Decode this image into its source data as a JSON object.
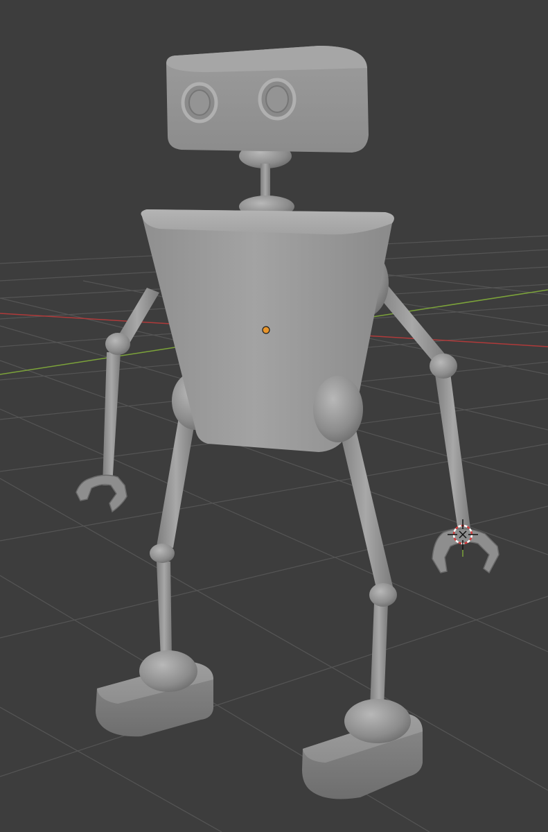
{
  "viewport": {
    "background": "#3d3d3d",
    "grid_color": "#555555",
    "x_axis_color": "#b03a3a",
    "y_axis_color": "#7ca33a"
  },
  "scene": {
    "object_material_color": "#9a9a9a",
    "origin_marker_color": "#e8952b",
    "cursor_icon": "3d-cursor-icon",
    "origin_icon": "object-origin-icon"
  }
}
